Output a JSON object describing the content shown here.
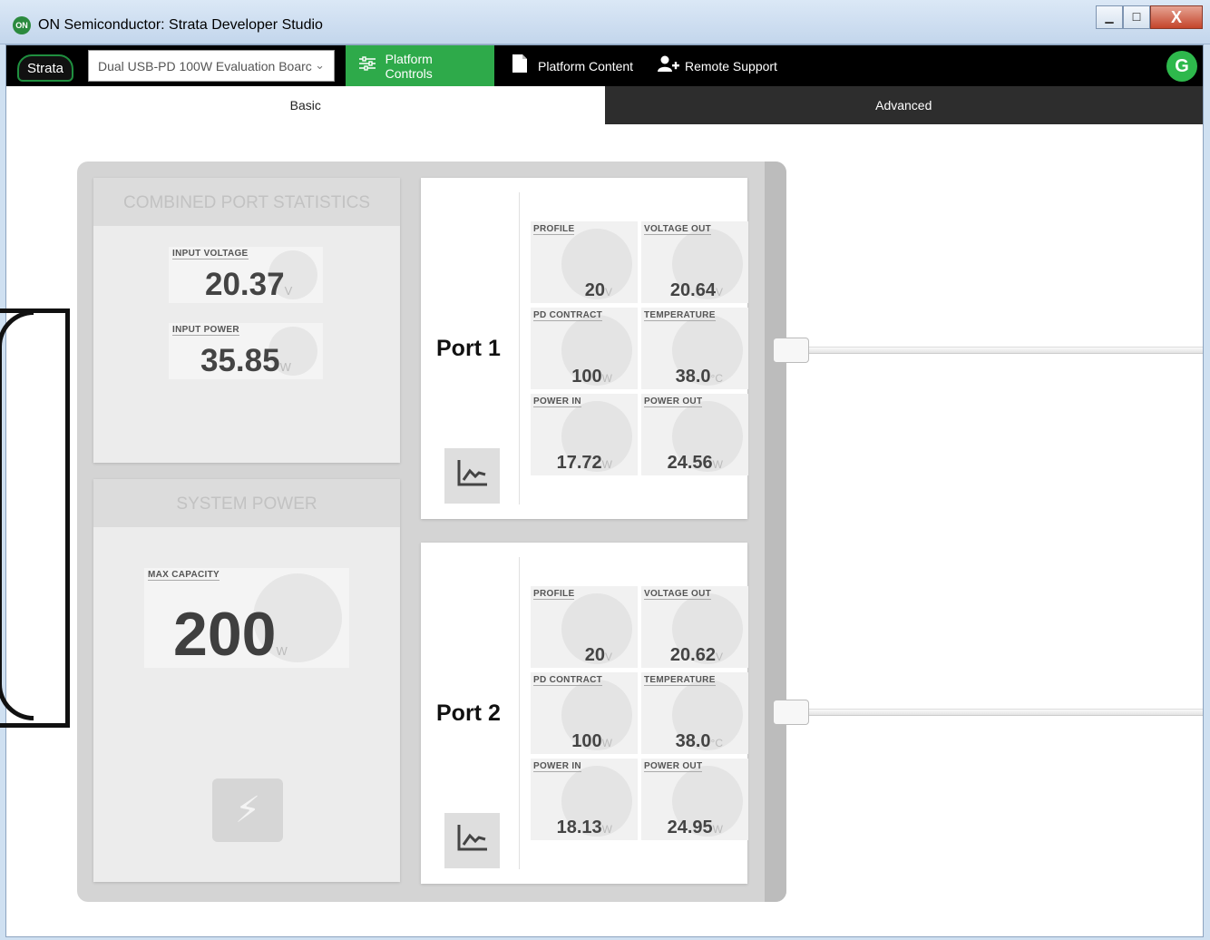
{
  "window": {
    "title": "ON Semiconductor: Strata Developer Studio",
    "app_icon": "ON",
    "minimize": "▁",
    "maximize": "☐",
    "close": "X"
  },
  "topbar": {
    "logo": "Strata",
    "platform_select": "Dual USB-PD 100W Evaluation Boarc",
    "nav": [
      {
        "label": "Platform Controls",
        "icon": "sliders-icon"
      },
      {
        "label": "Platform Content",
        "icon": "document-icon"
      },
      {
        "label": "Remote Support",
        "icon": "add-user-icon"
      }
    ],
    "avatar": "G"
  },
  "tabs": {
    "basic": "Basic",
    "advanced": "Advanced"
  },
  "combined": {
    "title": "COMBINED PORT STATISTICS",
    "input_voltage": {
      "label": "INPUT VOLTAGE",
      "value": "20.37",
      "unit": "V"
    },
    "input_power": {
      "label": "INPUT POWER",
      "value": "35.85",
      "unit": "W"
    }
  },
  "system": {
    "title": "SYSTEM POWER",
    "max_capacity": {
      "label": "MAX CAPACITY",
      "value": "200",
      "unit": "W"
    }
  },
  "ports": [
    {
      "name": "Port 1",
      "profile": {
        "label": "PROFILE",
        "value": "20",
        "unit": "V"
      },
      "voltage_out": {
        "label": "VOLTAGE OUT",
        "value": "20.64",
        "unit": "V"
      },
      "pd_contract": {
        "label": "PD CONTRACT",
        "value": "100",
        "unit": "W"
      },
      "temperature": {
        "label": "TEMPERATURE",
        "value": "38.0",
        "unit": "°C"
      },
      "power_in": {
        "label": "POWER IN",
        "value": "17.72",
        "unit": "W"
      },
      "power_out": {
        "label": "POWER OUT",
        "value": "24.56",
        "unit": "W"
      }
    },
    {
      "name": "Port 2",
      "profile": {
        "label": "PROFILE",
        "value": "20",
        "unit": "V"
      },
      "voltage_out": {
        "label": "VOLTAGE OUT",
        "value": "20.62",
        "unit": "V"
      },
      "pd_contract": {
        "label": "PD CONTRACT",
        "value": "100",
        "unit": "W"
      },
      "temperature": {
        "label": "TEMPERATURE",
        "value": "38.0",
        "unit": "°C"
      },
      "power_in": {
        "label": "POWER IN",
        "value": "18.13",
        "unit": "W"
      },
      "power_out": {
        "label": "POWER OUT",
        "value": "24.95",
        "unit": "W"
      }
    }
  ],
  "colors": {
    "accent_green": "#2eaa4a",
    "nav_bg": "#000000",
    "advanced_tab_bg": "#2d2d2d"
  }
}
